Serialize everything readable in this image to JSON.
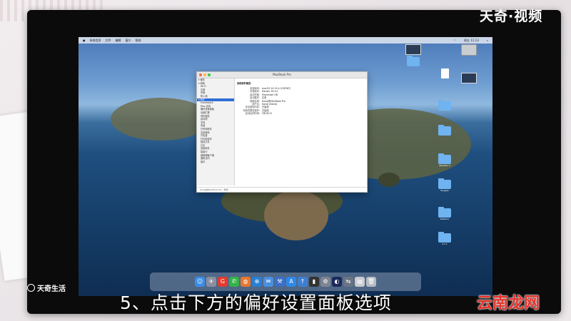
{
  "menubar": {
    "apple": "",
    "items": [
      "系统信息",
      "文件",
      "编辑",
      "窗口",
      "帮助"
    ],
    "clock": "周五 11:13"
  },
  "window": {
    "title": "MacBook Pro",
    "sidebar": {
      "items": [
        {
          "label": "▾ 硬件",
          "header": true
        },
        {
          "label": "▾ 网络",
          "header": true
        },
        {
          "label": "Wi-Fi"
        },
        {
          "label": "位置"
        },
        {
          "label": "宗卷"
        },
        {
          "label": "防火墙"
        },
        {
          "label": "▾ 软件",
          "header": true,
          "selected": true
        },
        {
          "label": "Framework"
        },
        {
          "label": "Raw 支持"
        },
        {
          "label": "偏好设置面板"
        },
        {
          "label": "功能扩展"
        },
        {
          "label": "同步服务"
        },
        {
          "label": "启动项"
        },
        {
          "label": "字体"
        },
        {
          "label": "安装"
        },
        {
          "label": "已停用软件"
        },
        {
          "label": "应用程序"
        },
        {
          "label": "开发者"
        },
        {
          "label": "打印机软件"
        },
        {
          "label": "描述文件"
        },
        {
          "label": "日志"
        },
        {
          "label": "旧版软件"
        },
        {
          "label": "智能卡"
        },
        {
          "label": "被管理客户端"
        },
        {
          "label": "通用访问"
        },
        {
          "label": "组件"
        }
      ]
    },
    "content": {
      "heading": "系统软件概览:",
      "rows": [
        {
          "k": "系统版本:",
          "v": "macOS 10.15.4 (19E287)"
        },
        {
          "k": "内核版本:",
          "v": "Darwin 19.4.0"
        },
        {
          "k": "启动宗卷:",
          "v": "Macintosh HD"
        },
        {
          "k": "启动模式:",
          "v": "正常"
        },
        {
          "k": "电脑名称:",
          "v": "tianqi的MacBook Pro"
        },
        {
          "k": "用户名:",
          "v": "tianqi (tianqi)"
        },
        {
          "k": "安全虚拟内存:",
          "v": "已启用"
        },
        {
          "k": "系统完整性保护:",
          "v": "已启用"
        },
        {
          "k": "启动后的时间:",
          "v": "3天18:21"
        }
      ]
    },
    "status": "tianqi的MacBook Pro › 软件"
  },
  "desktop_icons": [
    {
      "label": "",
      "kind": "thumb"
    },
    {
      "label": "",
      "kind": "hdd"
    },
    {
      "label": "",
      "kind": "folder"
    },
    {
      "label": "",
      "kind": "doc"
    },
    {
      "label": "",
      "kind": "thumb"
    },
    {
      "label": "",
      "kind": "folder"
    },
    {
      "label": "",
      "kind": "folder"
    },
    {
      "label": "Weather 2",
      "kind": "folder"
    },
    {
      "label": "Yangjian",
      "kind": "folder"
    },
    {
      "label": "Weather",
      "kind": "folder"
    },
    {
      "label": "4.1.1",
      "kind": "folder"
    }
  ],
  "dock": [
    "Finder",
    "Launchpad",
    "Google",
    "WeChat",
    "Firefox",
    "Safari",
    "Mail",
    "Xcode",
    "App Store",
    "Upload",
    "Terminal",
    "System Preferences",
    "Screen",
    "Migration",
    "Preview",
    "Trash"
  ],
  "overlay": {
    "brand_top": "天奇·视频",
    "brand_left": "天奇生活",
    "caption": "5、点击下方的偏好设置面板选项",
    "watermark": "云南龙网"
  },
  "colors": {
    "selection": "#2f6fd6",
    "folder": "#6fb3f0",
    "watermark": "#e8322a"
  }
}
